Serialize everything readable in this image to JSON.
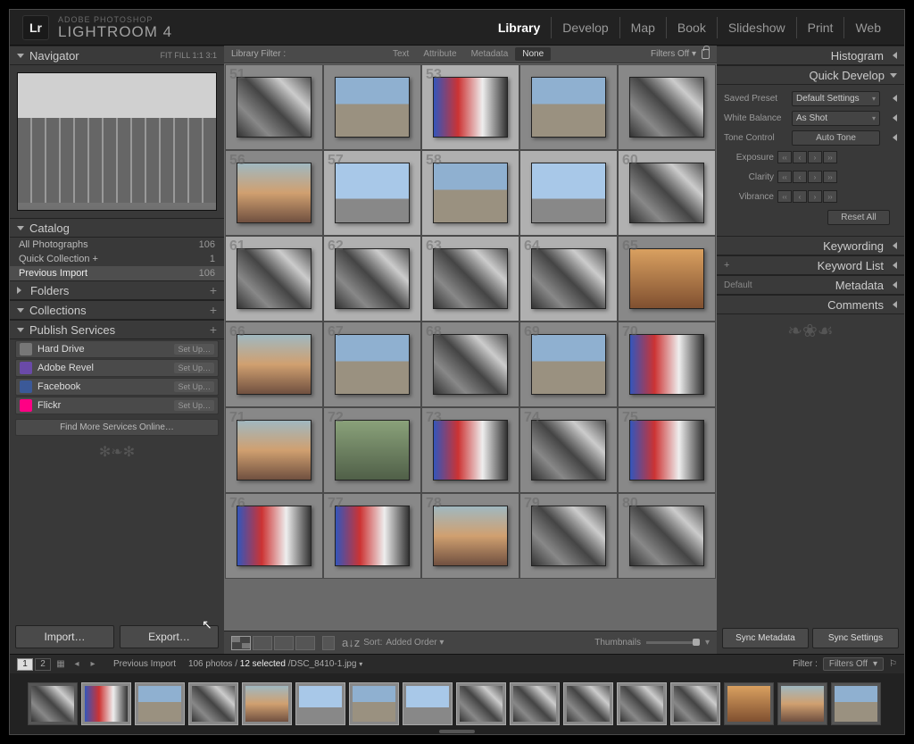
{
  "brand": {
    "logo": "Lr",
    "small": "ADOBE PHOTOSHOP",
    "big": "LIGHTROOM 4"
  },
  "modules": [
    "Library",
    "Develop",
    "Map",
    "Book",
    "Slideshow",
    "Print",
    "Web"
  ],
  "modules_active": "Library",
  "left": {
    "navigator": {
      "title": "Navigator",
      "zoom_opts": "FIT   FILL   1:1   3:1"
    },
    "catalog": {
      "title": "Catalog",
      "items": [
        {
          "label": "All Photographs",
          "count": "106"
        },
        {
          "label": "Quick Collection  +",
          "count": "1"
        },
        {
          "label": "Previous Import",
          "count": "106",
          "sel": true
        }
      ]
    },
    "folders": {
      "title": "Folders"
    },
    "collections": {
      "title": "Collections"
    },
    "publish": {
      "title": "Publish Services",
      "items": [
        {
          "name": "Hard Drive",
          "color": "#777",
          "setup": "Set Up…"
        },
        {
          "name": "Adobe Revel",
          "color": "#6a4aa8",
          "setup": "Set Up…"
        },
        {
          "name": "Facebook",
          "color": "#3b5998",
          "setup": "Set Up…"
        },
        {
          "name": "Flickr",
          "color": "#ff0084",
          "setup": "Set Up…"
        }
      ],
      "findmore": "Find More Services Online…"
    },
    "import_btn": "Import…",
    "export_btn": "Export…"
  },
  "filterbar": {
    "label": "Library Filter :",
    "tabs": [
      "Text",
      "Attribute",
      "Metadata",
      "None"
    ],
    "active": "None",
    "filters_off": "Filters Off"
  },
  "grid_numbers": [
    "51",
    "",
    "53",
    "",
    "",
    "56",
    "57",
    "58",
    "",
    "60",
    "61",
    "62",
    "63",
    "64",
    "65",
    "66",
    "67",
    "68",
    "69",
    "70",
    "71",
    "72",
    "73",
    "74",
    "75",
    "76",
    "77",
    "78",
    "79",
    "80"
  ],
  "grid_selected": [
    2,
    6,
    7,
    8,
    9,
    10,
    11,
    12,
    13
  ],
  "grid_styles": [
    "p-bw",
    "p-st",
    "p-rb",
    "p-st",
    "p-bw",
    "p-cr",
    "p-sk",
    "p-st",
    "p-sk",
    "p-bw",
    "p-bw",
    "p-bw",
    "p-bw",
    "p-bw",
    "p-or",
    "p-cr",
    "p-st",
    "p-bw",
    "p-st",
    "p-rb",
    "p-cr",
    "p-gr",
    "p-rb",
    "p-bw",
    "p-rb",
    "p-rb",
    "p-rb",
    "p-cr",
    "p-bw",
    "p-bw"
  ],
  "toolbar": {
    "sort_lbl": "Sort:",
    "sort_val": "Added Order",
    "thumbs_lbl": "Thumbnails"
  },
  "right": {
    "histogram": "Histogram",
    "quickdev": {
      "title": "Quick Develop",
      "rows": {
        "preset_lbl": "Saved Preset",
        "preset_val": "Default Settings",
        "wb_lbl": "White Balance",
        "wb_val": "As Shot",
        "tone_lbl": "Tone Control",
        "tone_btn": "Auto Tone",
        "exposure": "Exposure",
        "clarity": "Clarity",
        "vibrance": "Vibrance"
      },
      "reset": "Reset All"
    },
    "keywording": "Keywording",
    "keywordlist": "Keyword List",
    "metadata": {
      "title": "Metadata",
      "preset": "Default"
    },
    "comments": "Comments",
    "sync_meta": "Sync Metadata",
    "sync_set": "Sync Settings"
  },
  "status": {
    "pages": [
      "1",
      "2"
    ],
    "source": "Previous Import",
    "count": "106 photos /",
    "selected": "12 selected",
    "file": " /DSC_8410-1.jpg",
    "filter_lbl": "Filter :",
    "filter_val": "Filters Off"
  },
  "filmstrip_sel": [
    1,
    2,
    3,
    4,
    5,
    6,
    7,
    8,
    9,
    10,
    11,
    12
  ],
  "filmstrip_styles": [
    "p-bw",
    "p-rb",
    "p-st",
    "p-bw",
    "p-cr",
    "p-sk",
    "p-st",
    "p-sk",
    "p-bw",
    "p-bw",
    "p-bw",
    "p-bw",
    "p-bw",
    "p-or",
    "p-cr",
    "p-st"
  ]
}
